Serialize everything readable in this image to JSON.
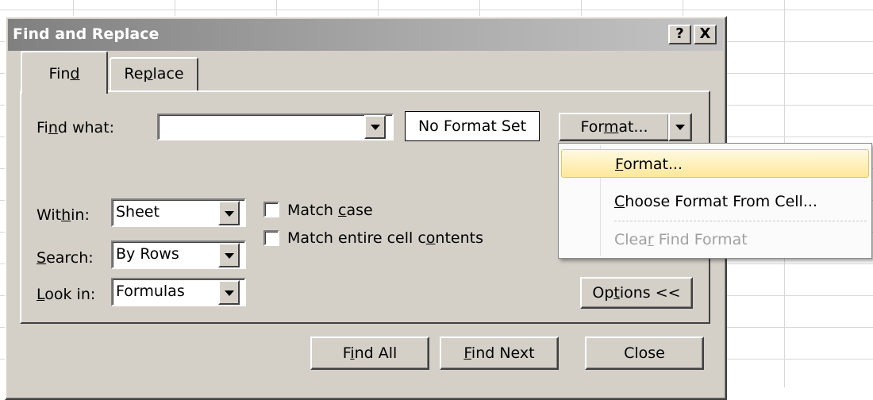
{
  "dialog": {
    "title": "Find and Replace",
    "help_button": "?",
    "close_button": "X"
  },
  "tabs": [
    {
      "label_parts": [
        "Fin",
        "d",
        ""
      ],
      "selected": true
    },
    {
      "label_parts": [
        "Re",
        "p",
        "lace"
      ],
      "selected": false
    }
  ],
  "find_what": {
    "label_parts": [
      "Fi",
      "n",
      "d what:"
    ],
    "value": "",
    "format_preview": "No Format Set",
    "format_button_parts": [
      "For",
      "m",
      "at..."
    ]
  },
  "options": {
    "within": {
      "label_parts": [
        "Wit",
        "h",
        "in:"
      ],
      "value": "Sheet"
    },
    "search": {
      "label_parts": [
        "",
        "S",
        "earch:"
      ],
      "value": "By Rows"
    },
    "look_in": {
      "label_parts": [
        "",
        "L",
        "ook in:"
      ],
      "value": "Formulas"
    },
    "match_case": {
      "label_parts": [
        "Match ",
        "c",
        "ase"
      ],
      "checked": false
    },
    "match_entire": {
      "label_parts": [
        "Match entire cell c",
        "o",
        "ntents"
      ],
      "checked": false
    },
    "options_button_parts": [
      "Op",
      "t",
      "ions <<"
    ]
  },
  "buttons": {
    "find_all_parts": [
      "F",
      "i",
      "nd All"
    ],
    "find_next_parts": [
      "",
      "F",
      "ind Next"
    ],
    "close": "Close"
  },
  "format_menu": {
    "items": [
      {
        "parts": [
          "",
          "F",
          "ormat..."
        ],
        "highlighted": true,
        "enabled": true
      },
      {
        "parts": [
          "",
          "C",
          "hoose Format From Cell..."
        ],
        "highlighted": false,
        "enabled": true
      },
      {
        "parts": [
          "Clea",
          "r",
          " Find Format"
        ],
        "highlighted": false,
        "enabled": false
      }
    ]
  },
  "colors": {
    "dialog_bg": "#d4d0c8",
    "titlebar_inactive": "#808080",
    "menu_highlight": "#ffe89a"
  }
}
